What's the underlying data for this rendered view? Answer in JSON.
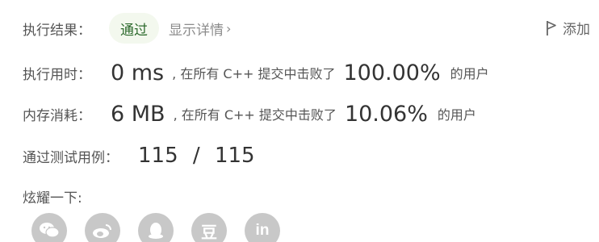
{
  "result": {
    "label": "执行结果：",
    "status": "通过",
    "details_link": "显示详情",
    "details_chevron": "›",
    "add_note": "添加"
  },
  "runtime": {
    "label": "执行用时：",
    "value": "0 ms",
    "beat_text": ", 在所有 C++ 提交中击败了",
    "percent": "100.00%",
    "users_text": "的用户"
  },
  "memory": {
    "label": "内存消耗：",
    "value": "6 MB",
    "beat_text": ", 在所有 C++ 提交中击败了",
    "percent": "10.06%",
    "users_text": "的用户"
  },
  "testcases": {
    "label": "通过测试用例：",
    "passed": "115",
    "slash": "/",
    "total": "115"
  },
  "share": {
    "label": "炫耀一下:",
    "icons": [
      "wechat-icon",
      "weibo-icon",
      "qq-icon",
      "douban-icon",
      "linkedin-icon"
    ],
    "douban_glyph": "豆",
    "linkedin_glyph": "in"
  },
  "colors": {
    "pass_badge_bg": "#f3f8ee",
    "pass_badge_text": "#2d6a2d",
    "share_icon_bg": "#c8c8c8"
  }
}
